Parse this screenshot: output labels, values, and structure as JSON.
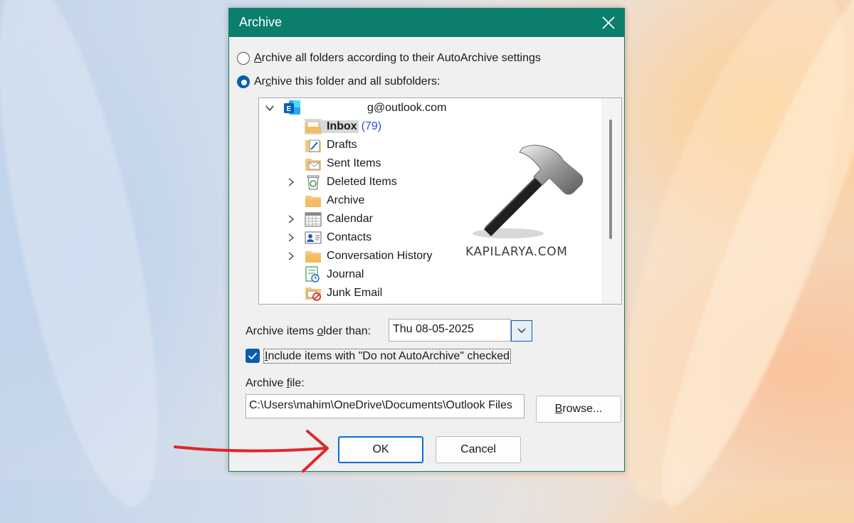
{
  "dialog": {
    "title": "Archive",
    "option_all_pre": "",
    "option_all_accel": "A",
    "option_all_post": "rchive all folders according to their AutoArchive settings",
    "option_this_pre": "Ar",
    "option_this_accel": "c",
    "option_this_post": "hive this folder and all subfolders:",
    "selected_option": "this_folder"
  },
  "tree": {
    "account": "g@outlook.com",
    "items": [
      {
        "label": "Inbox",
        "count": "(79)",
        "icon": "inbox-folder-icon",
        "expandable": false,
        "selected": true
      },
      {
        "label": "Drafts",
        "icon": "drafts-folder-icon",
        "expandable": false
      },
      {
        "label": "Sent Items",
        "icon": "sent-folder-icon",
        "expandable": false
      },
      {
        "label": "Deleted Items",
        "icon": "recycle-bin-icon",
        "expandable": true
      },
      {
        "label": "Archive",
        "icon": "folder-icon",
        "expandable": false
      },
      {
        "label": "Calendar",
        "icon": "calendar-icon",
        "expandable": true
      },
      {
        "label": "Contacts",
        "icon": "contacts-icon",
        "expandable": true
      },
      {
        "label": "Conversation History",
        "icon": "folder-icon",
        "expandable": true
      },
      {
        "label": "Journal",
        "icon": "journal-icon",
        "expandable": false
      },
      {
        "label": "Junk Email",
        "icon": "junk-folder-icon",
        "expandable": false
      }
    ]
  },
  "watermark": "KAPILARYA.COM",
  "older_than": {
    "label_pre": "Archive items ",
    "label_accel": "o",
    "label_post": "lder than:",
    "value": "Thu 08-05-2025"
  },
  "include": {
    "checked": true,
    "label_accel": "I",
    "label_post": "nclude items with \"Do not AutoArchive\" checked"
  },
  "archive_file": {
    "label_pre": "Archive ",
    "label_accel": "f",
    "label_post": "ile:",
    "value": "C:\\Users\\mahim\\OneDrive\\Documents\\Outlook Files"
  },
  "buttons": {
    "browse_accel": "B",
    "browse_post": "rowse...",
    "ok": "OK",
    "cancel": "Cancel"
  },
  "colors": {
    "titlebar": "#0c7f6c",
    "accent": "#0b5cad",
    "annotation_arrow": "#e0262a"
  }
}
